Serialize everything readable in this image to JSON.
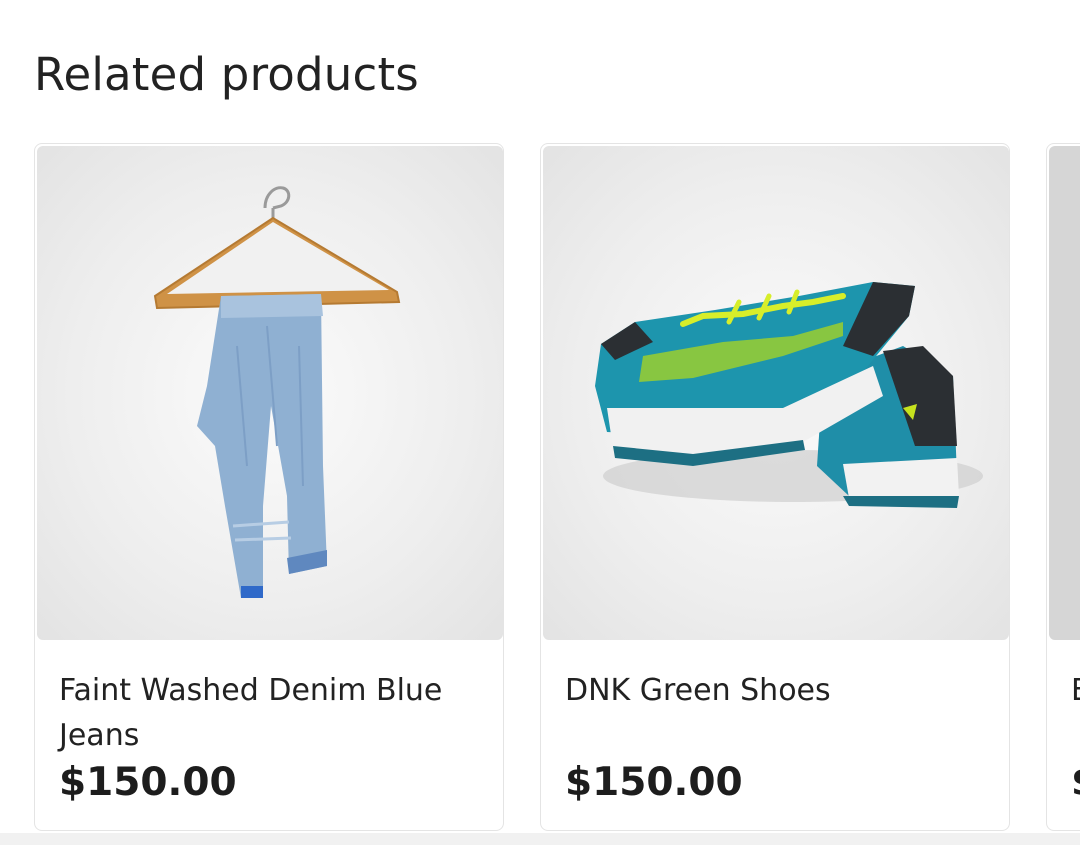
{
  "section": {
    "title": "Related products"
  },
  "products": [
    {
      "name": "Faint Washed Denim Blue Jeans",
      "price": "$150.00",
      "image_icon": "jeans-on-hanger-image"
    },
    {
      "name": "DNK Green Shoes",
      "price": "$150.00",
      "image_icon": "green-sneakers-image"
    },
    {
      "name": "E",
      "price": "$",
      "image_icon": "product-image"
    }
  ],
  "colors": {
    "text": "#222222",
    "price": "#1d1d1d",
    "card_border": "#e4e4e4",
    "image_bg": "#eeeeee"
  }
}
